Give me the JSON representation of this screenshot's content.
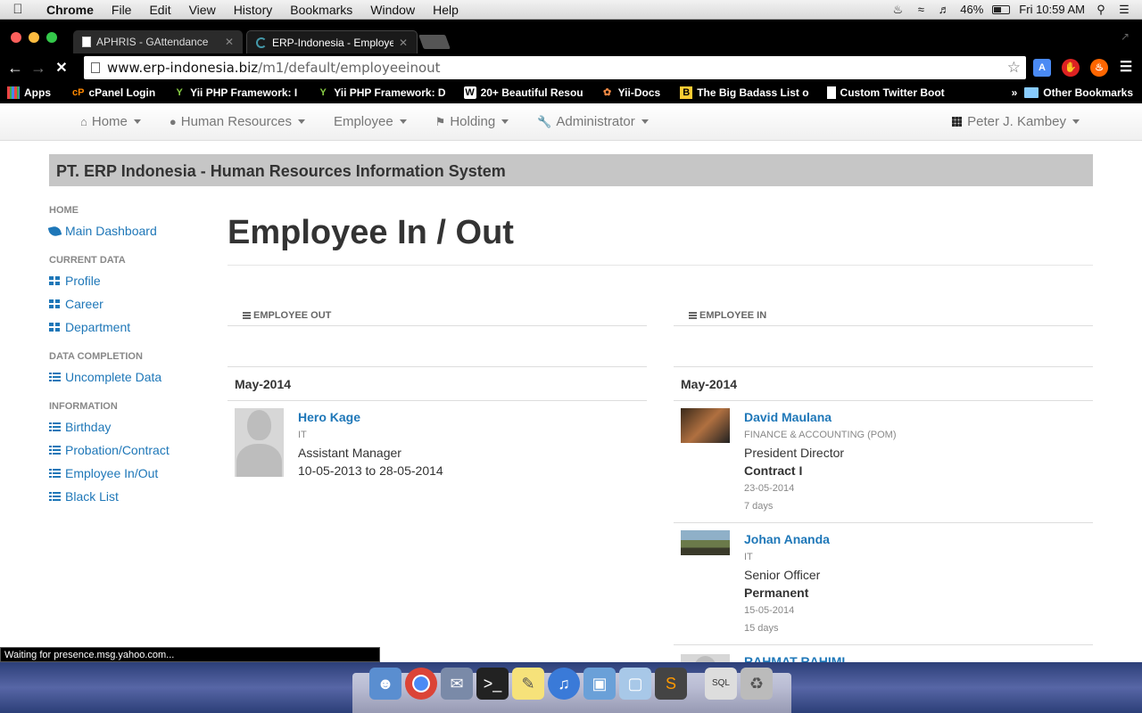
{
  "mac_menu": {
    "app": "Chrome",
    "items": [
      "File",
      "Edit",
      "View",
      "History",
      "Bookmarks",
      "Window",
      "Help"
    ],
    "battery": "46%",
    "clock": "Fri 10:59 AM"
  },
  "tabs": [
    {
      "label": "APHRIS - GAttendance"
    },
    {
      "label": "ERP-Indonesia - Employee"
    }
  ],
  "address": {
    "domain": "www.erp-indonesia.biz",
    "path": "/m1/default/employeeinout"
  },
  "bookmarks": {
    "items": [
      "Apps",
      "cPanel Login",
      "Yii PHP Framework: I",
      "Yii PHP Framework: D",
      "20+ Beautiful Resou",
      "Yii-Docs",
      "The Big Badass List o",
      "Custom Twitter Boot"
    ],
    "more": "»",
    "other": "Other Bookmarks"
  },
  "navbar": {
    "items": [
      "Home",
      "Human Resources",
      "Employee",
      "Holding",
      "Administrator"
    ],
    "user": "Peter J. Kambey"
  },
  "banner": "PT. ERP Indonesia - Human Resources Information System",
  "sidebar": {
    "sections": [
      {
        "heading": "HOME",
        "links": [
          "Main Dashboard"
        ]
      },
      {
        "heading": "CURRENT DATA",
        "links": [
          "Profile",
          "Career",
          "Department"
        ]
      },
      {
        "heading": "DATA COMPLETION",
        "links": [
          "Uncomplete Data"
        ]
      },
      {
        "heading": "INFORMATION",
        "links": [
          "Birthday",
          "Probation/Contract",
          "Employee In/Out",
          "Black List"
        ]
      }
    ]
  },
  "page_title": "Employee In / Out",
  "employee_out": {
    "heading": "EMPLOYEE OUT",
    "month": "May-2014",
    "people": [
      {
        "name": "Hero Kage",
        "dept": "IT",
        "position": "Assistant Manager",
        "period": "10-05-2013 to 28-05-2014"
      }
    ]
  },
  "employee_in": {
    "heading": "EMPLOYEE IN",
    "month": "May-2014",
    "people": [
      {
        "name": "David Maulana",
        "dept": "FINANCE & ACCOUNTING (POM)",
        "position": "President Director",
        "status": "Contract I",
        "date": "23-05-2014",
        "days": "7 days"
      },
      {
        "name": "Johan Ananda",
        "dept": "IT",
        "position": "Senior Officer",
        "status": "Permanent",
        "date": "15-05-2014",
        "days": "15 days"
      },
      {
        "name": "RAHMAT RAHIMI"
      }
    ]
  },
  "status_text": "Waiting for presence.msg.yahoo.com..."
}
